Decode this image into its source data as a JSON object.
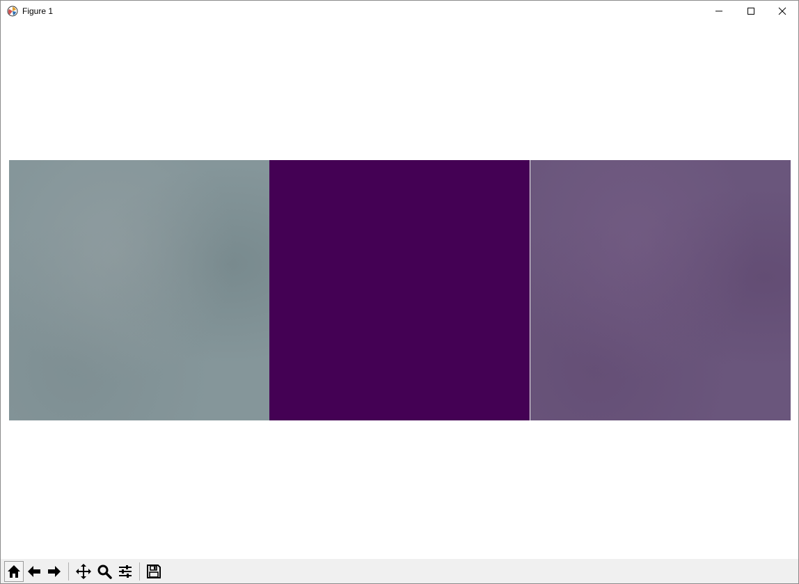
{
  "window": {
    "title": "Figure 1",
    "app_icon": "matplotlib-icon",
    "controls": [
      "minimize-icon",
      "maximize-icon",
      "close-icon"
    ]
  },
  "figure": {
    "panels": [
      {
        "name": "image-panel-1",
        "base_color": "#85969a"
      },
      {
        "name": "image-panel-2",
        "base_color": "#440154"
      },
      {
        "name": "image-panel-3",
        "base_color": "#6a567c"
      }
    ]
  },
  "toolbar": {
    "buttons": [
      {
        "name": "home-button",
        "icon": "home-icon"
      },
      {
        "name": "back-button",
        "icon": "arrow-left-icon"
      },
      {
        "name": "forward-button",
        "icon": "arrow-right-icon"
      },
      {
        "name": "pan-button",
        "icon": "move-icon"
      },
      {
        "name": "zoom-button",
        "icon": "magnifier-icon"
      },
      {
        "name": "configure-subplots-button",
        "icon": "sliders-icon"
      },
      {
        "name": "save-button",
        "icon": "floppy-disk-icon"
      }
    ]
  },
  "colors": {
    "toolbar_bg": "#f0f0f0",
    "window_bg": "#ffffff"
  }
}
